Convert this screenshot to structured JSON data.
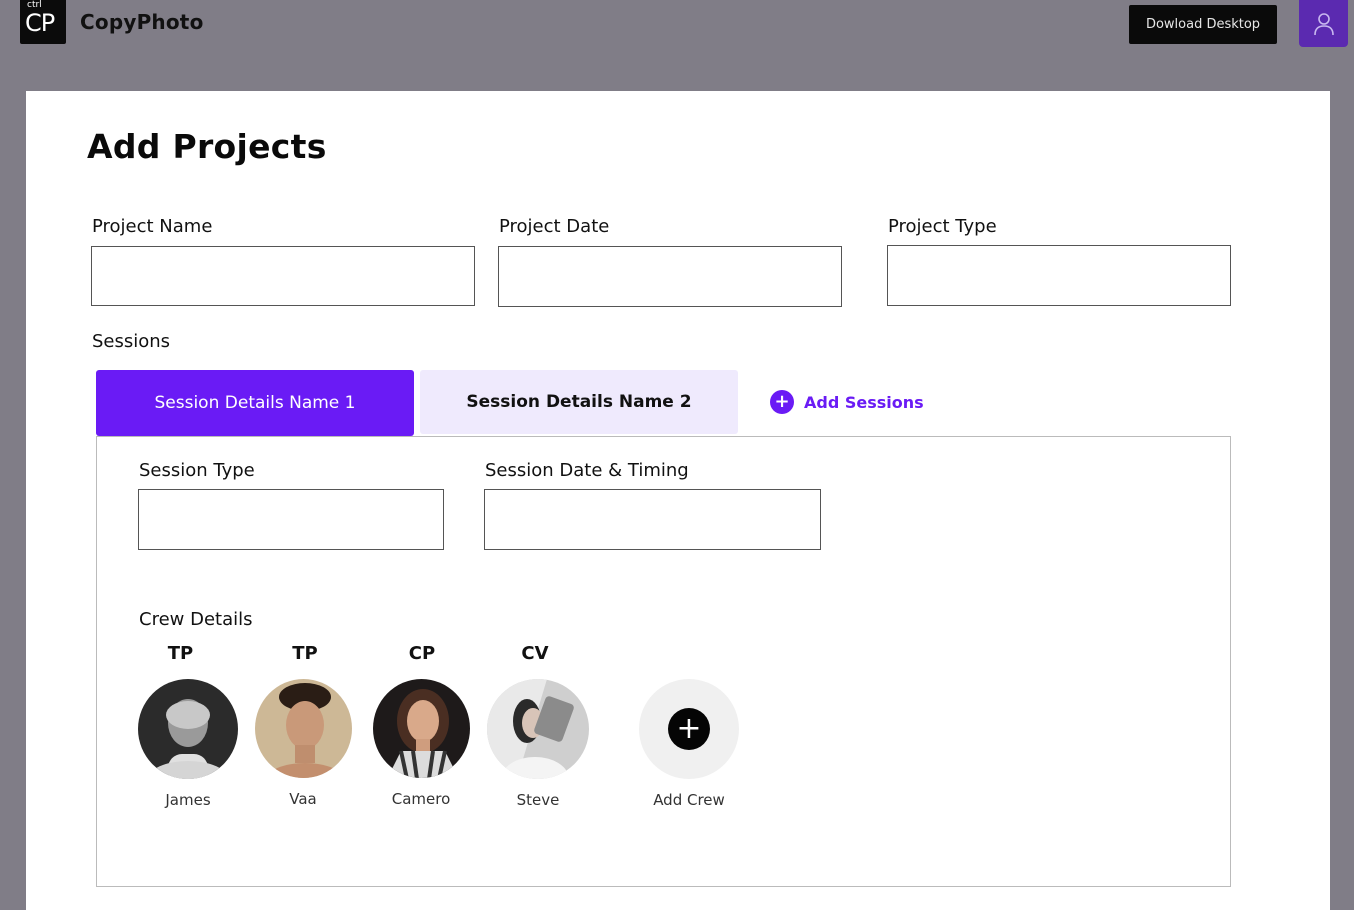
{
  "header": {
    "logo_small": "ctrl",
    "logo_big": "CP",
    "app_name": "CopyPhoto",
    "download_label": "Dowload Desktop",
    "user_icon": "user-icon"
  },
  "page": {
    "title": "Add Projects"
  },
  "form": {
    "project_name": {
      "label": "Project Name",
      "value": ""
    },
    "project_date": {
      "label": "Project Date",
      "value": ""
    },
    "project_type": {
      "label": "Project Type",
      "value": ""
    }
  },
  "sessions": {
    "label": "Sessions",
    "tabs": [
      {
        "label": "Session Details Name 1",
        "active": true
      },
      {
        "label": "Session Details Name 2",
        "active": false
      }
    ],
    "add_label": "Add Sessions",
    "session_type": {
      "label": "Session Type",
      "value": ""
    },
    "session_date": {
      "label": "Session Date & Timing",
      "value": ""
    }
  },
  "crew": {
    "label": "Crew Details",
    "members": [
      {
        "role": "TP",
        "name": "James"
      },
      {
        "role": "TP",
        "name": "Vaa"
      },
      {
        "role": "CP",
        "name": "Camero"
      },
      {
        "role": "CV",
        "name": "Steve"
      }
    ],
    "add_label": "Add Crew"
  },
  "colors": {
    "accent": "#6a1bf5",
    "tab_inactive_bg": "#efeafd",
    "backdrop": "#807d87",
    "user_button": "#5b2ab0"
  }
}
